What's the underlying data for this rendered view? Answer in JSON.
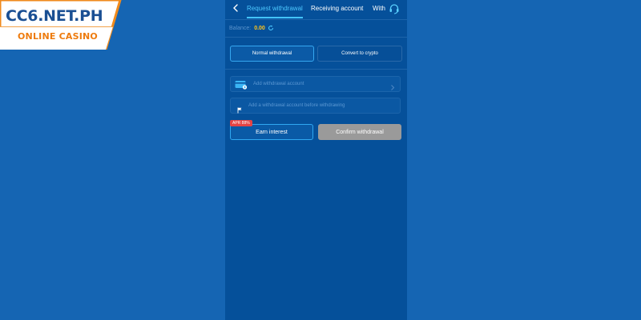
{
  "brand": {
    "title": "CC6.NET.PH",
    "subtitle": "ONLINE CASINO"
  },
  "nav": {
    "tabs": [
      {
        "label": "Request withdrawal",
        "active": true
      },
      {
        "label": "Receiving account",
        "active": false
      },
      {
        "label": "With",
        "active": false
      }
    ],
    "icons": [
      "chevron-left-icon",
      "headset-icon"
    ]
  },
  "balance": {
    "label": "Balance:",
    "value": "0.00",
    "icon": "refresh-icon"
  },
  "withdraw_methods": {
    "normal": "Normal withdrawal",
    "crypto": "Convert to crypto",
    "selected": "normal"
  },
  "account": {
    "add_label": "Add withdrawal account",
    "hint": "Add a withdrawal account before withdrawing"
  },
  "actions": {
    "earn_interest": "Earn interest",
    "apr_badge": "APR 88%",
    "confirm": "Confirm withdrawal"
  },
  "colors": {
    "background": "#1565b3",
    "panel": "#05509a",
    "accent": "#43c3ff",
    "balance_value": "#ffc41a",
    "badge": "#e44444",
    "disabled_button": "#9a9a9a",
    "logo_blue": "#1a4f93",
    "logo_orange": "#ee7b0d"
  }
}
